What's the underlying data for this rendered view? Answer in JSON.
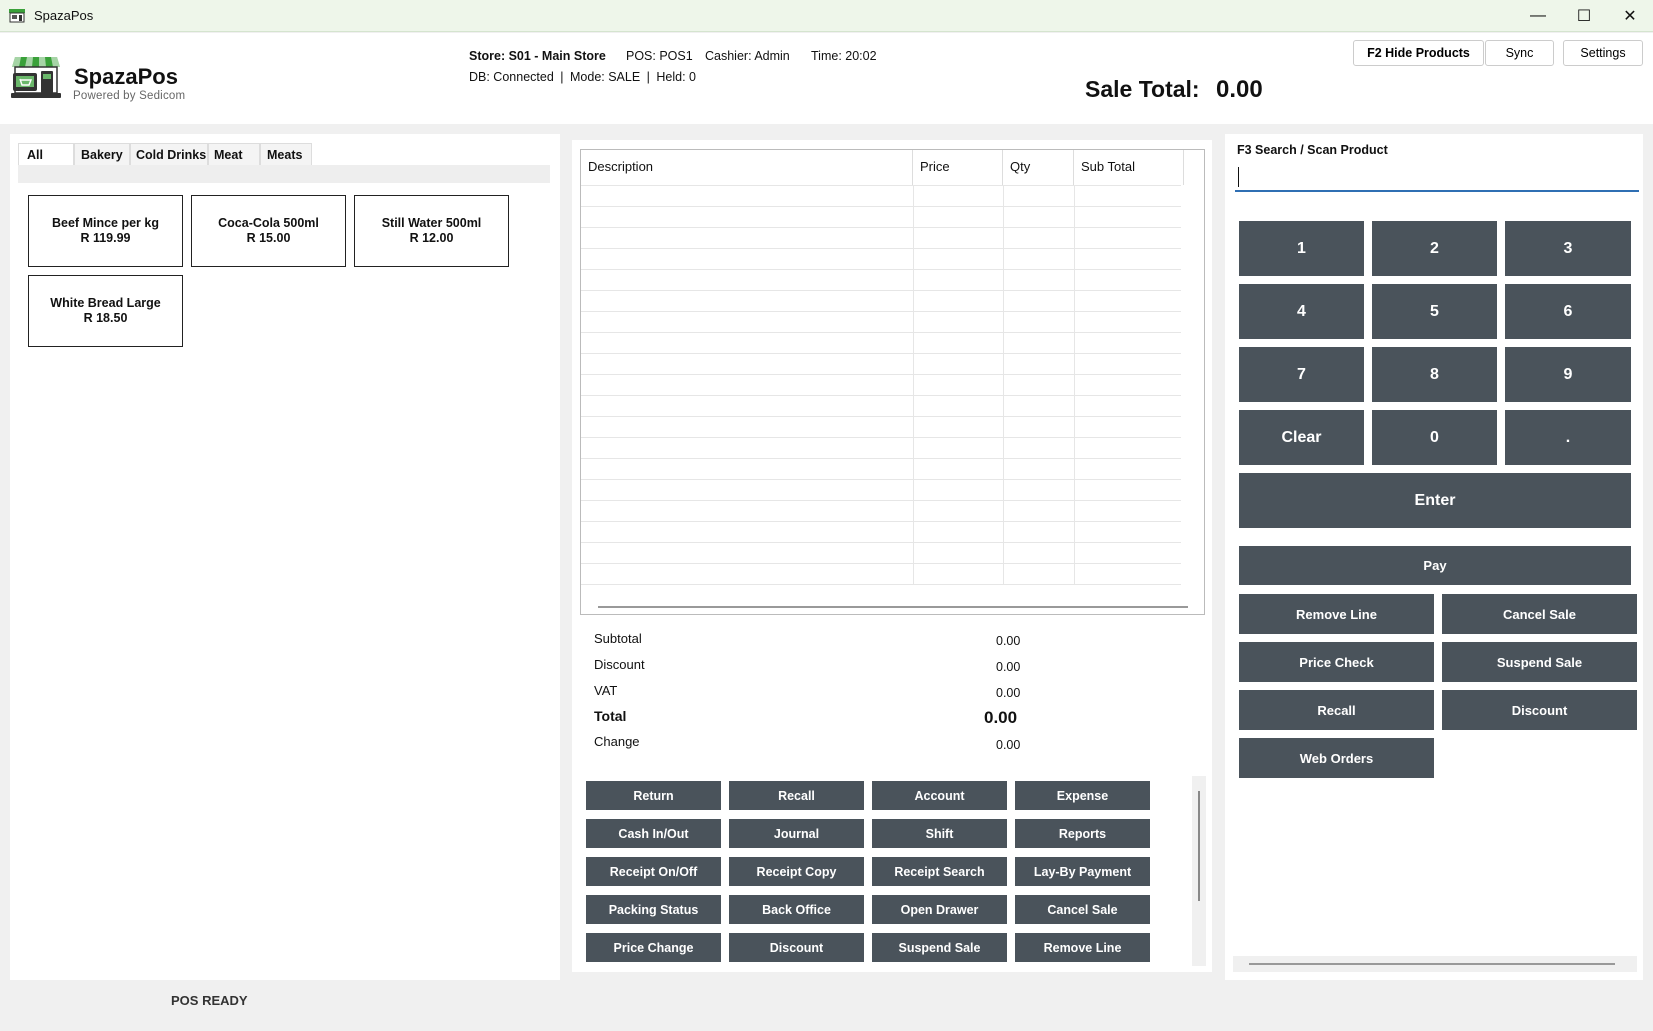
{
  "window": {
    "title": "SpazaPos",
    "icon": "pos-app-icon",
    "controls": {
      "minimize": "—",
      "maximize": "☐",
      "close": "✕"
    }
  },
  "header": {
    "brand_name": "SpazaPos",
    "brand_sub": "Powered by Sedicom",
    "store": "Store: S01 - Main Store",
    "pos": "POS: POS1",
    "cashier": "Cashier: Admin",
    "time": "Time: 20:02",
    "db": "DB: Connected",
    "mode": "Mode: SALE",
    "held": "Held: 0",
    "separator": "|",
    "sale_total_label": "Sale Total:",
    "sale_total_value": "0.00",
    "buttons": {
      "hide_products": "F2  Hide Products",
      "sync": "Sync",
      "settings": "Settings"
    }
  },
  "categories": {
    "tabs": [
      "All",
      "Bakery",
      "Cold Drinks",
      "Meat",
      "Meats"
    ],
    "active": "All"
  },
  "products": [
    {
      "name": "Beef Mince per kg",
      "price": "R 119.99"
    },
    {
      "name": "Coca-Cola 500ml",
      "price": "R 15.00"
    },
    {
      "name": "Still Water 500ml",
      "price": "R 12.00"
    },
    {
      "name": "White Bread Large",
      "price": "R 18.50"
    }
  ],
  "cart": {
    "columns": [
      "Description",
      "Price",
      "Qty",
      "Sub Total"
    ],
    "rows": []
  },
  "totals": {
    "subtotal_label": "Subtotal",
    "subtotal": "0.00",
    "discount_label": "Discount",
    "discount": "0.00",
    "vat_label": "VAT",
    "vat": "0.00",
    "total_label": "Total",
    "total": "0.00",
    "change_label": "Change",
    "change": "0.00"
  },
  "function_buttons": [
    [
      "Return",
      "Recall",
      "Account",
      "Expense"
    ],
    [
      "Cash In/Out",
      "Journal",
      "Shift",
      "Reports"
    ],
    [
      "Receipt On/Off",
      "Receipt Copy",
      "Receipt Search",
      "Lay-By Payment"
    ],
    [
      "Packing Status",
      "Back Office",
      "Open Drawer",
      "Cancel Sale"
    ],
    [
      "Price Change",
      "Discount",
      "Suspend Sale",
      "Remove Line"
    ]
  ],
  "search": {
    "label": "F3  Search / Scan Product",
    "value": "",
    "placeholder": ""
  },
  "keypad": {
    "keys": [
      "1",
      "2",
      "3",
      "4",
      "5",
      "6",
      "7",
      "8",
      "9",
      "Clear",
      "0",
      "."
    ],
    "enter": "Enter"
  },
  "actions": {
    "pay": "Pay",
    "remove_line": "Remove Line",
    "cancel_sale": "Cancel Sale",
    "price_check": "Price Check",
    "suspend_sale": "Suspend Sale",
    "recall": "Recall",
    "discount": "Discount",
    "web_orders": "Web Orders"
  },
  "status": "POS READY",
  "colors": {
    "button_bg": "#4a535b",
    "title_bar_bg": "#eef6ea",
    "search_underline": "#2f6fb3",
    "logo_green": "#3aa13a"
  }
}
